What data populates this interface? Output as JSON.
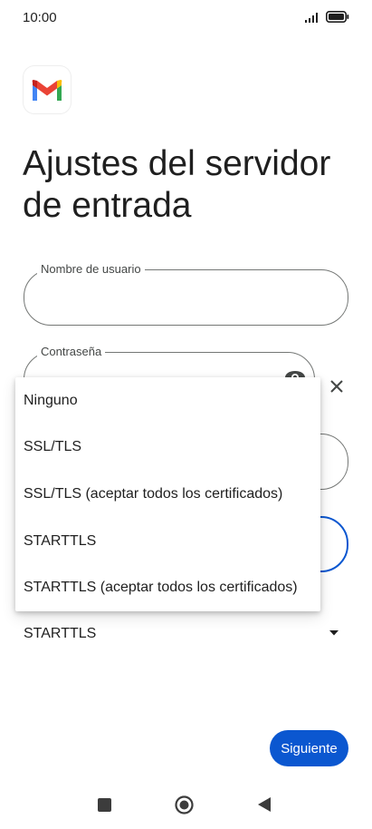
{
  "status_bar": {
    "time": "10:00",
    "signal_icon": "signal-icon",
    "battery_icon": "battery-icon"
  },
  "app": {
    "logo_icon": "gmail-logo-icon"
  },
  "page": {
    "title": "Ajustes del servidor de entrada"
  },
  "form": {
    "username_label": "Nombre de usuario",
    "username_value": "",
    "password_label": "Contraseña",
    "password_value": "",
    "security_selected": "STARTTLS"
  },
  "dropdown": {
    "options": [
      "Ninguno",
      "SSL/TLS",
      "SSL/TLS (aceptar todos los certificados)",
      "STARTTLS",
      "STARTTLS (aceptar todos los certificados)"
    ]
  },
  "actions": {
    "next_label": "Siguiente"
  },
  "colors": {
    "primary": "#0b57d0",
    "outline": "#747775",
    "text": "#1f1f1f"
  }
}
